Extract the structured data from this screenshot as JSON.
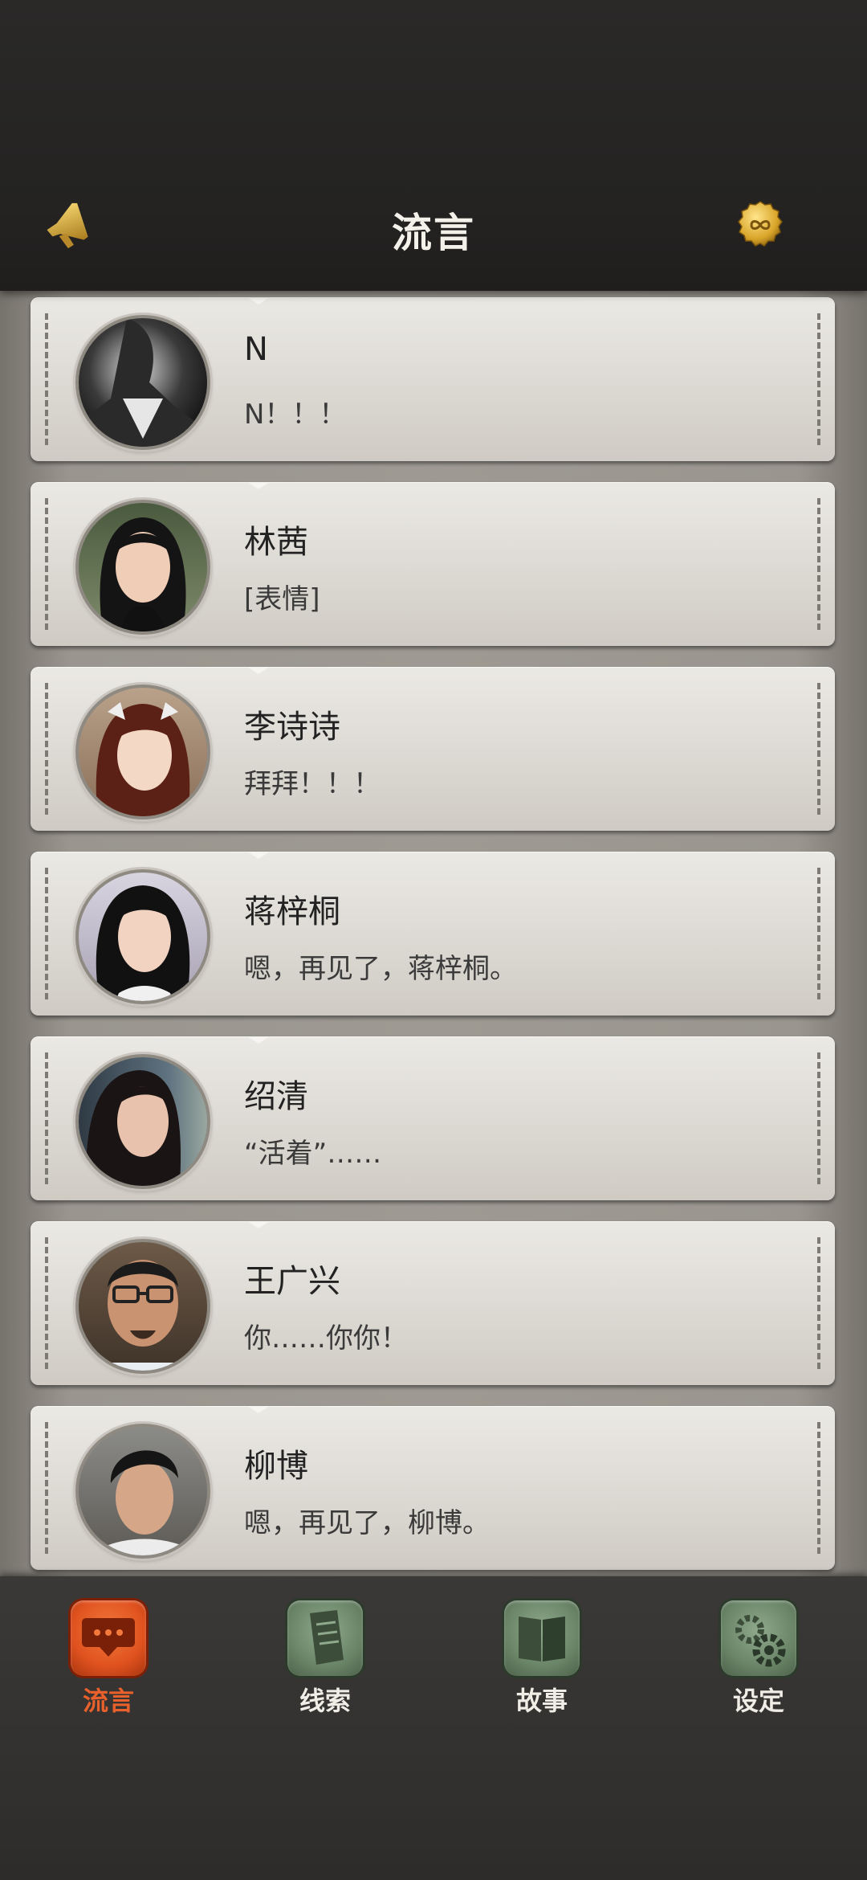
{
  "header": {
    "title": "流言",
    "left_icon": "megaphone-icon",
    "right_icon": "infinity-coin-icon"
  },
  "colors": {
    "header_bg": "#242322",
    "card_bg": "#e3e0da",
    "nav_bg": "#33312f",
    "active_accent": "#e8602b",
    "inactive_icon": "#6a8568"
  },
  "chats": [
    {
      "name": "N",
      "message": "N！！！",
      "avatar": "man-bw-avatar"
    },
    {
      "name": "林茜",
      "message": "[表情]",
      "avatar": "woman-avatar"
    },
    {
      "name": "李诗诗",
      "message": "拜拜！！！",
      "avatar": "woman-avatar"
    },
    {
      "name": "蒋梓桐",
      "message": "嗯，再见了，蒋梓桐。",
      "avatar": "woman-avatar"
    },
    {
      "name": "绍清",
      "message": "“活着”……",
      "avatar": "woman-avatar"
    },
    {
      "name": "王广兴",
      "message": "你……你你！",
      "avatar": "man-glasses-avatar"
    },
    {
      "name": "柳博",
      "message": "嗯，再见了，柳博。",
      "avatar": "man-avatar"
    }
  ],
  "nav": [
    {
      "label": "流言",
      "icon": "chat-bubble-icon",
      "active": true
    },
    {
      "label": "线索",
      "icon": "document-icon",
      "active": false
    },
    {
      "label": "故事",
      "icon": "book-icon",
      "active": false
    },
    {
      "label": "设定",
      "icon": "gear-icon",
      "active": false
    }
  ]
}
